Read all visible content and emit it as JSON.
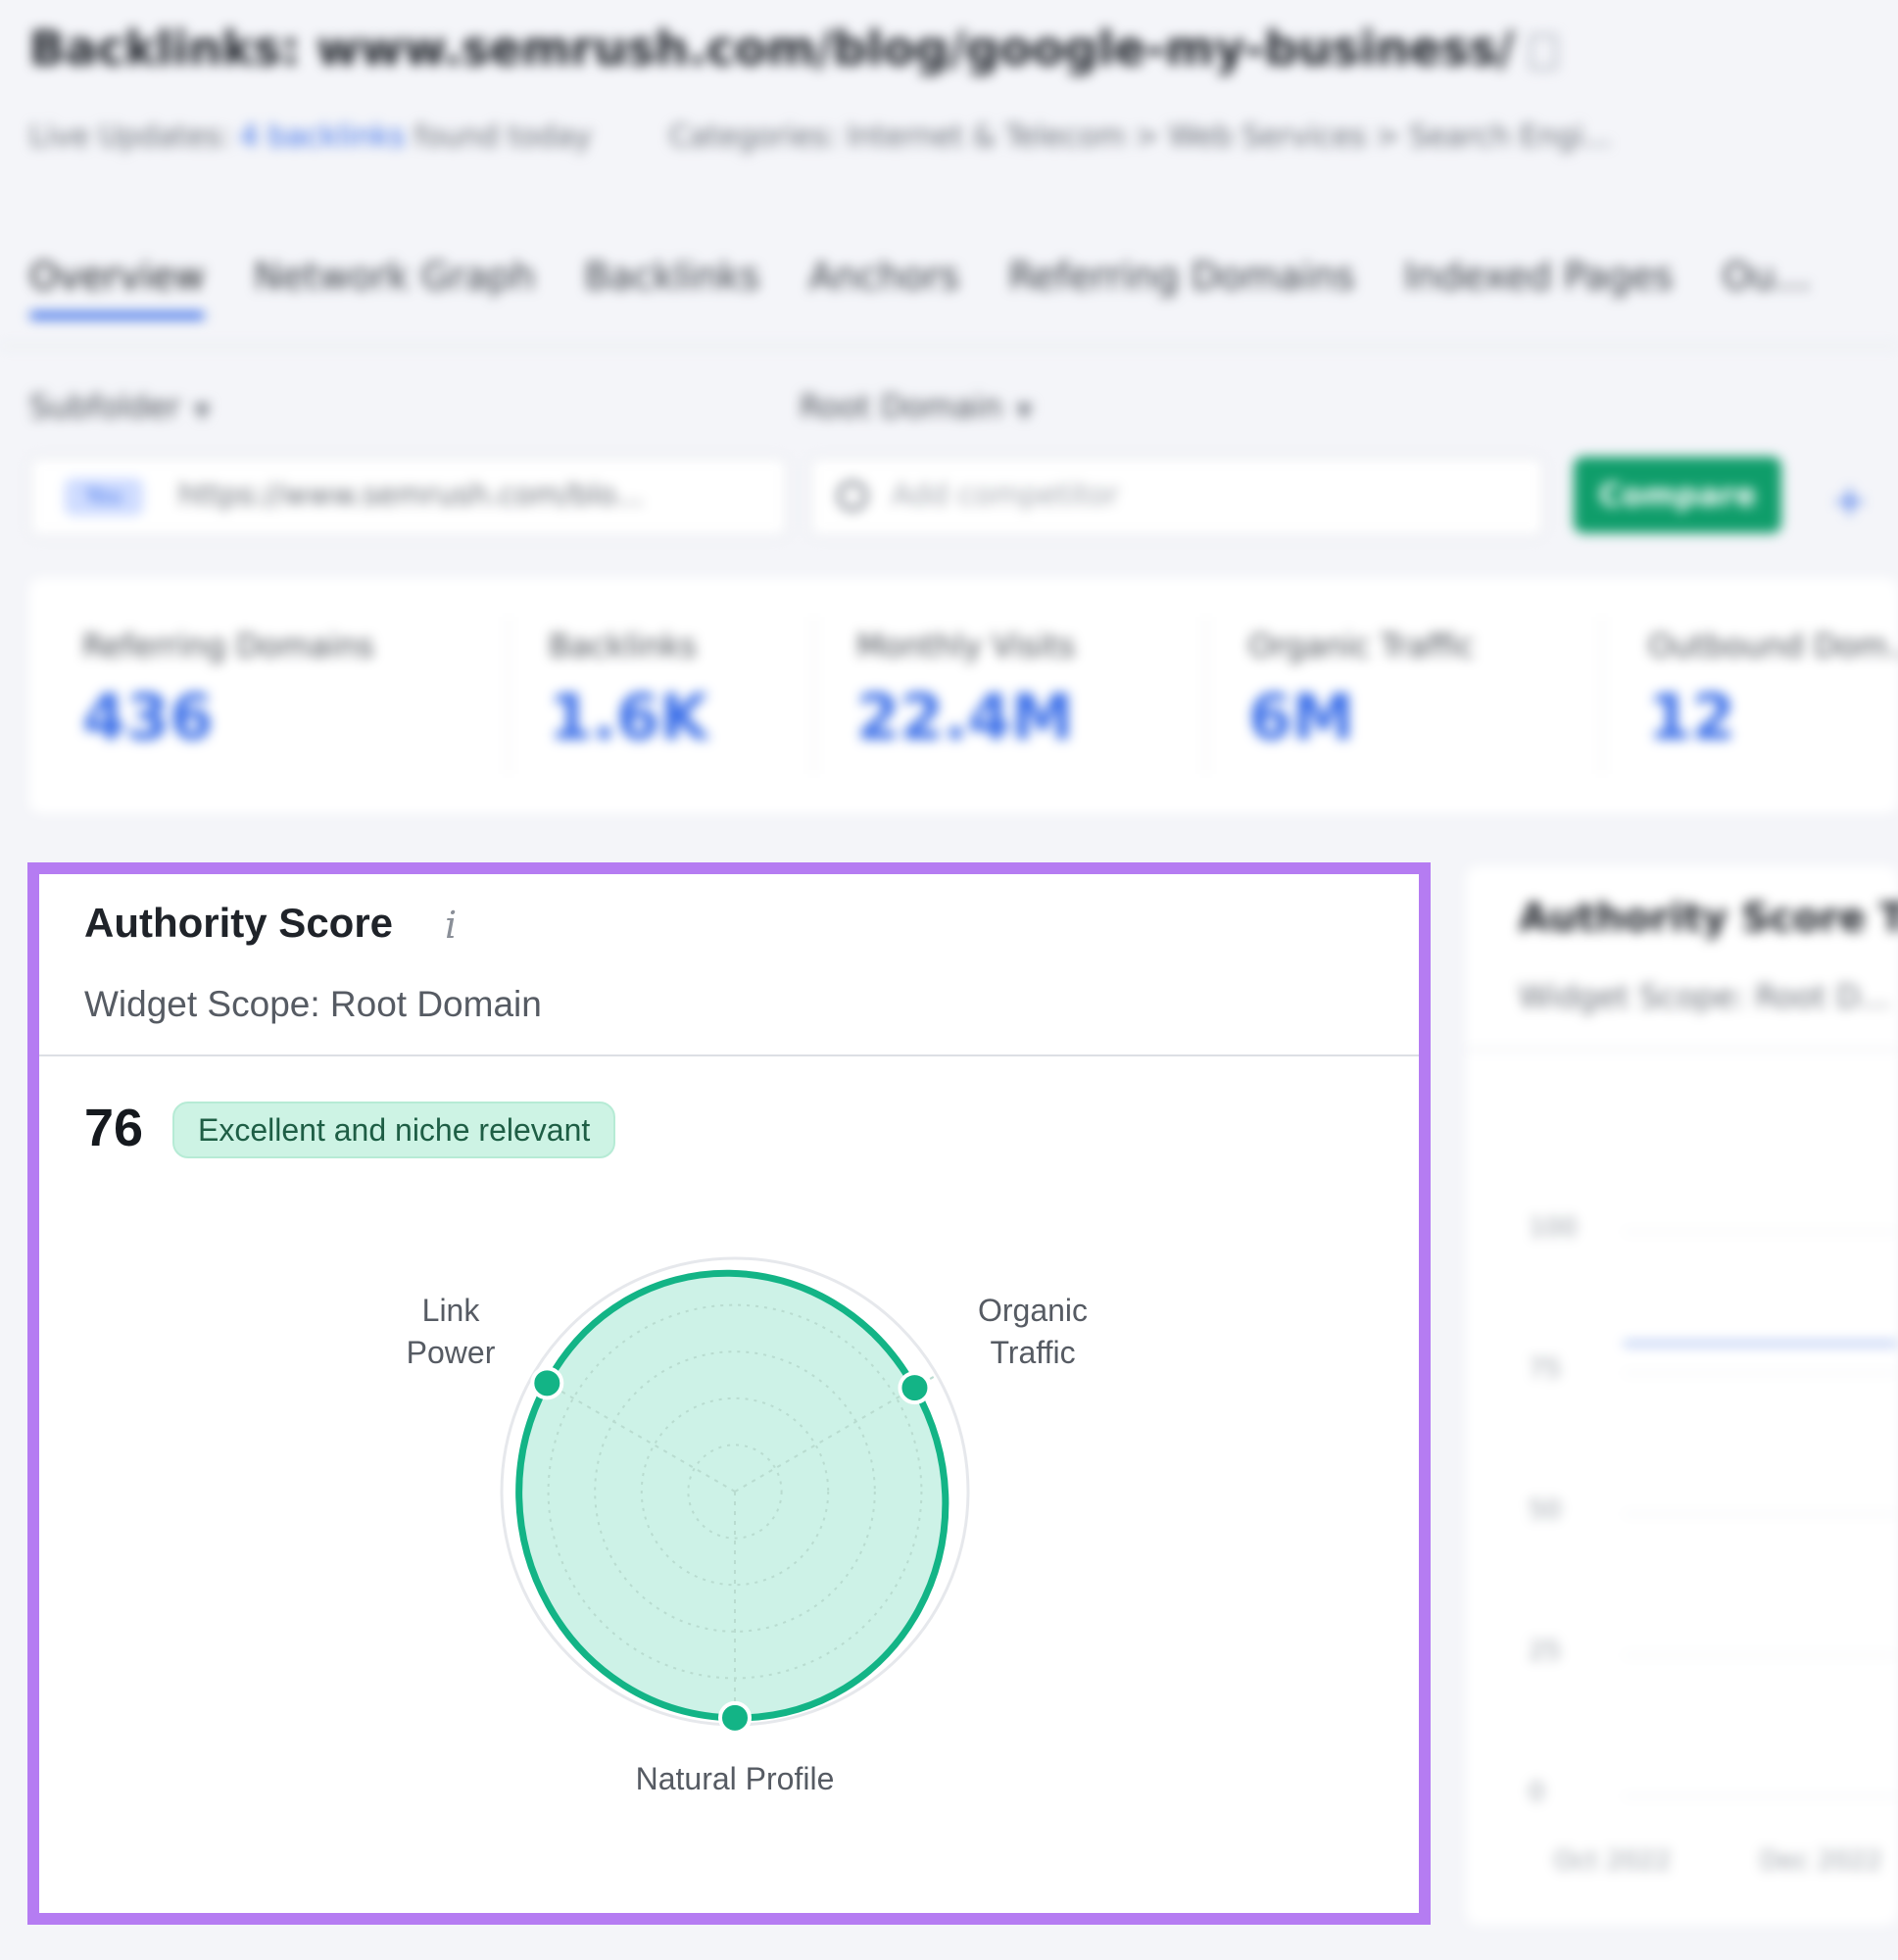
{
  "header": {
    "title": "Backlinks: www.semrush.com/blog/google-my-business/",
    "live_updates_label": "Live Updates:",
    "live_updates_link": "4 backlinks",
    "live_updates_suffix": "found today",
    "categories": "Categories: Internet & Telecom > Web Services > Search Engi..."
  },
  "tabs": [
    {
      "label": "Overview",
      "active": true
    },
    {
      "label": "Network Graph"
    },
    {
      "label": "Backlinks"
    },
    {
      "label": "Anchors"
    },
    {
      "label": "Referring Domains"
    },
    {
      "label": "Indexed Pages"
    },
    {
      "label": "Ou..."
    }
  ],
  "filters": {
    "left_dropdown": "Subfolder",
    "right_dropdown": "Root Domain",
    "you_tag": "You",
    "url_value": "https://www.semrush.com/blo...",
    "competitor_placeholder": "Add competitor",
    "compare_label": "Compare"
  },
  "metrics": [
    {
      "label": "Referring Domains",
      "value": "436"
    },
    {
      "label": "Backlinks",
      "value": "1.6K"
    },
    {
      "label": "Monthly Visits",
      "value": "22.4M"
    },
    {
      "label": "Organic Traffic",
      "value": "6M"
    },
    {
      "label": "Outbound Dom...",
      "value": "12"
    }
  ],
  "authority_card": {
    "title": "Authority Score",
    "info_icon": "i",
    "scope": "Widget Scope: Root Domain",
    "score": "76",
    "badge": "Excellent and niche relevant",
    "axes": {
      "link_power_line1": "Link",
      "link_power_line2": "Power",
      "organic_traffic_line1": "Organic",
      "organic_traffic_line2": "Traffic",
      "natural_profile": "Natural Profile"
    },
    "colors": {
      "accent": "#13b486",
      "fill": "#c8f1e4",
      "border": "#b57cf2"
    }
  },
  "trend_card": {
    "title": "Authority Score Tr...",
    "scope": "Widget Scope: Root D...",
    "y_ticks": [
      "100",
      "75",
      "50",
      "25",
      "0"
    ],
    "x_ticks": [
      "Oct 2022",
      "Dec 2022"
    ]
  },
  "chart_data": {
    "type": "radar",
    "axes": [
      "Link Power",
      "Organic Traffic",
      "Natural Profile"
    ],
    "values": [
      93,
      89,
      97
    ],
    "rmax": 100,
    "rings": 5
  }
}
